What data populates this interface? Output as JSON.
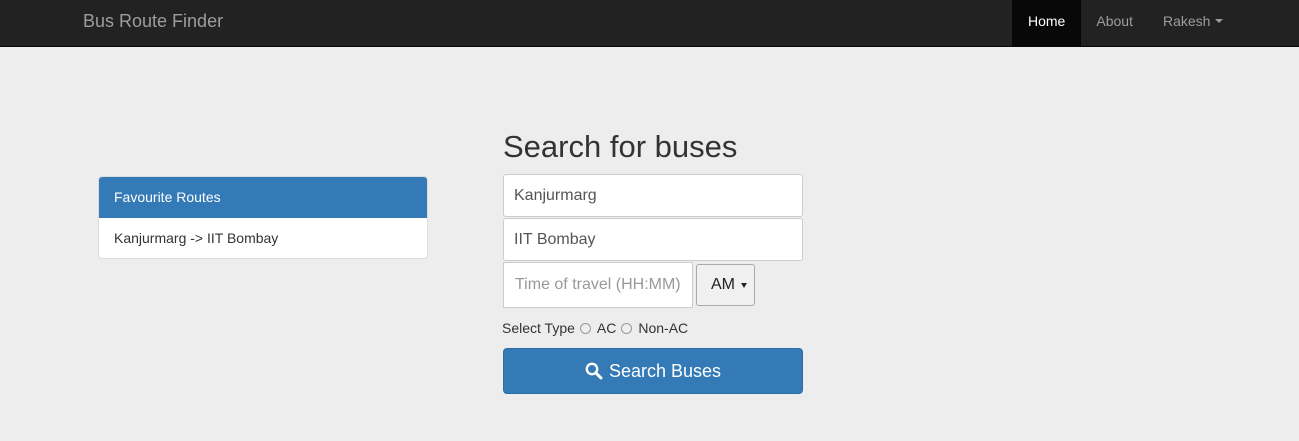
{
  "navbar": {
    "brand": "Bus Route Finder",
    "items": [
      {
        "label": "Home"
      },
      {
        "label": "About"
      },
      {
        "label": "Rakesh"
      }
    ]
  },
  "favourites": {
    "heading": "Favourite Routes",
    "routes": [
      "Kanjurmarg -> IIT Bombay"
    ]
  },
  "search": {
    "title": "Search for buses",
    "from_value": "Kanjurmarg",
    "to_value": "IIT Bombay",
    "time_placeholder": "Time of travel (HH:MM)",
    "ampm_selected": "AM",
    "type_label": "Select Type",
    "type_options": [
      "AC",
      "Non-AC"
    ],
    "button_label": "Search Buses"
  },
  "colors": {
    "navbar_bg": "#222222",
    "primary": "#337ab7",
    "page_bg": "#ededed"
  }
}
